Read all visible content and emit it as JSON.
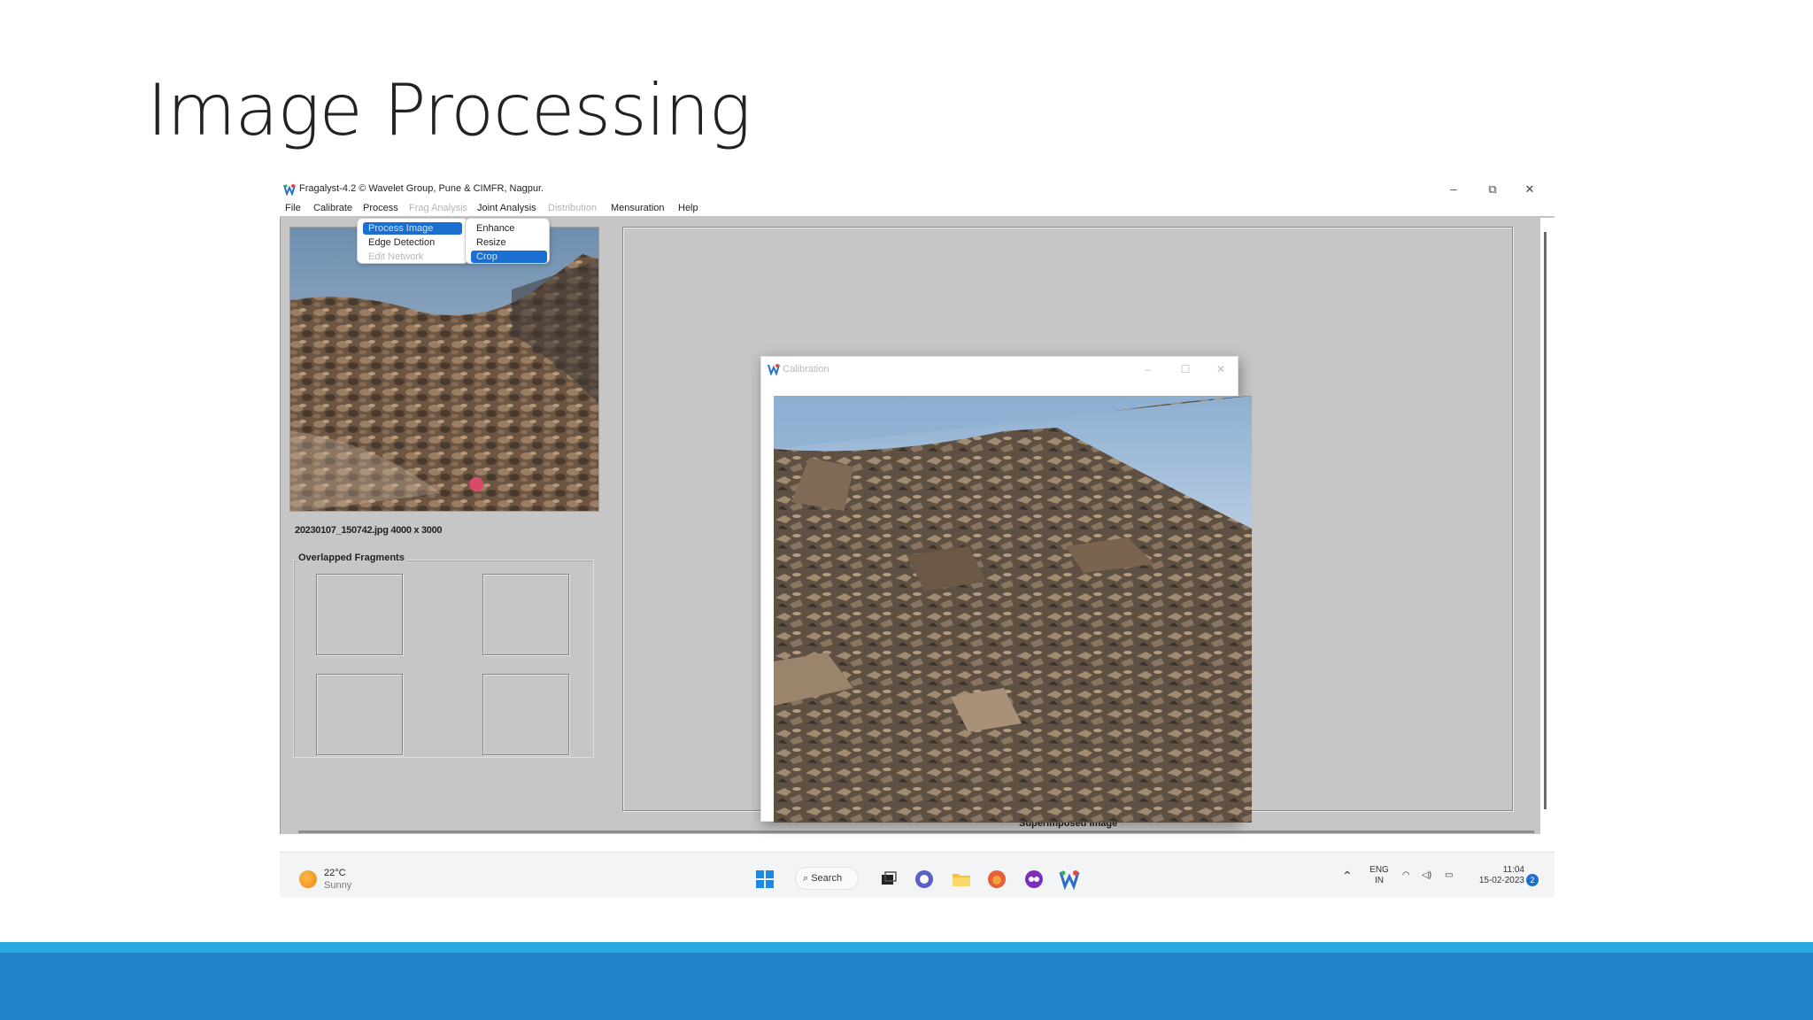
{
  "slide": {
    "title": "Image Processing"
  },
  "window": {
    "title": "Fragalyst-4.2 © Wavelet Group, Pune & CIMFR, Nagpur.",
    "minimize": "–",
    "restore": "⧉",
    "close": "✕"
  },
  "menu": {
    "items": [
      {
        "label": "File",
        "enabled": true
      },
      {
        "label": "Calibrate",
        "enabled": true
      },
      {
        "label": "Process",
        "enabled": true
      },
      {
        "label": "Frag Analysis",
        "enabled": false
      },
      {
        "label": "Joint Analysis",
        "enabled": true
      },
      {
        "label": "Distribution",
        "enabled": false
      },
      {
        "label": "Mensuration",
        "enabled": true
      },
      {
        "label": "Help",
        "enabled": true
      }
    ]
  },
  "process_menu": {
    "items": [
      {
        "label": "Process Image",
        "state": "selected"
      },
      {
        "label": "Edge Detection",
        "state": "normal"
      },
      {
        "label": "Edit Network",
        "state": "disabled"
      }
    ]
  },
  "process_image_submenu": {
    "items": [
      {
        "label": "Enhance",
        "state": "normal"
      },
      {
        "label": "Resize",
        "state": "normal"
      },
      {
        "label": "Crop",
        "state": "selected"
      }
    ]
  },
  "left_panel": {
    "file_info": "20230107_150742.jpg   4000  x  3000",
    "overlapped_label": "Overlapped Fragments"
  },
  "main_panel": {
    "label": "Superimposed Image"
  },
  "calibration_window": {
    "title": "Calibration",
    "minimize": "–",
    "maximize": "☐",
    "close": "✕"
  },
  "taskbar": {
    "temperature": "22°C",
    "condition": "Sunny",
    "search_label": "Search",
    "language": "ENG",
    "region": "IN",
    "time": "11:04",
    "date": "15-02-2023",
    "notification_count": "2"
  },
  "colors": {
    "app_background": "#c6c6c6",
    "menu_selection": "#1a6fd0",
    "footer_light": "#29a9e0",
    "footer_dark": "#2181c9"
  }
}
